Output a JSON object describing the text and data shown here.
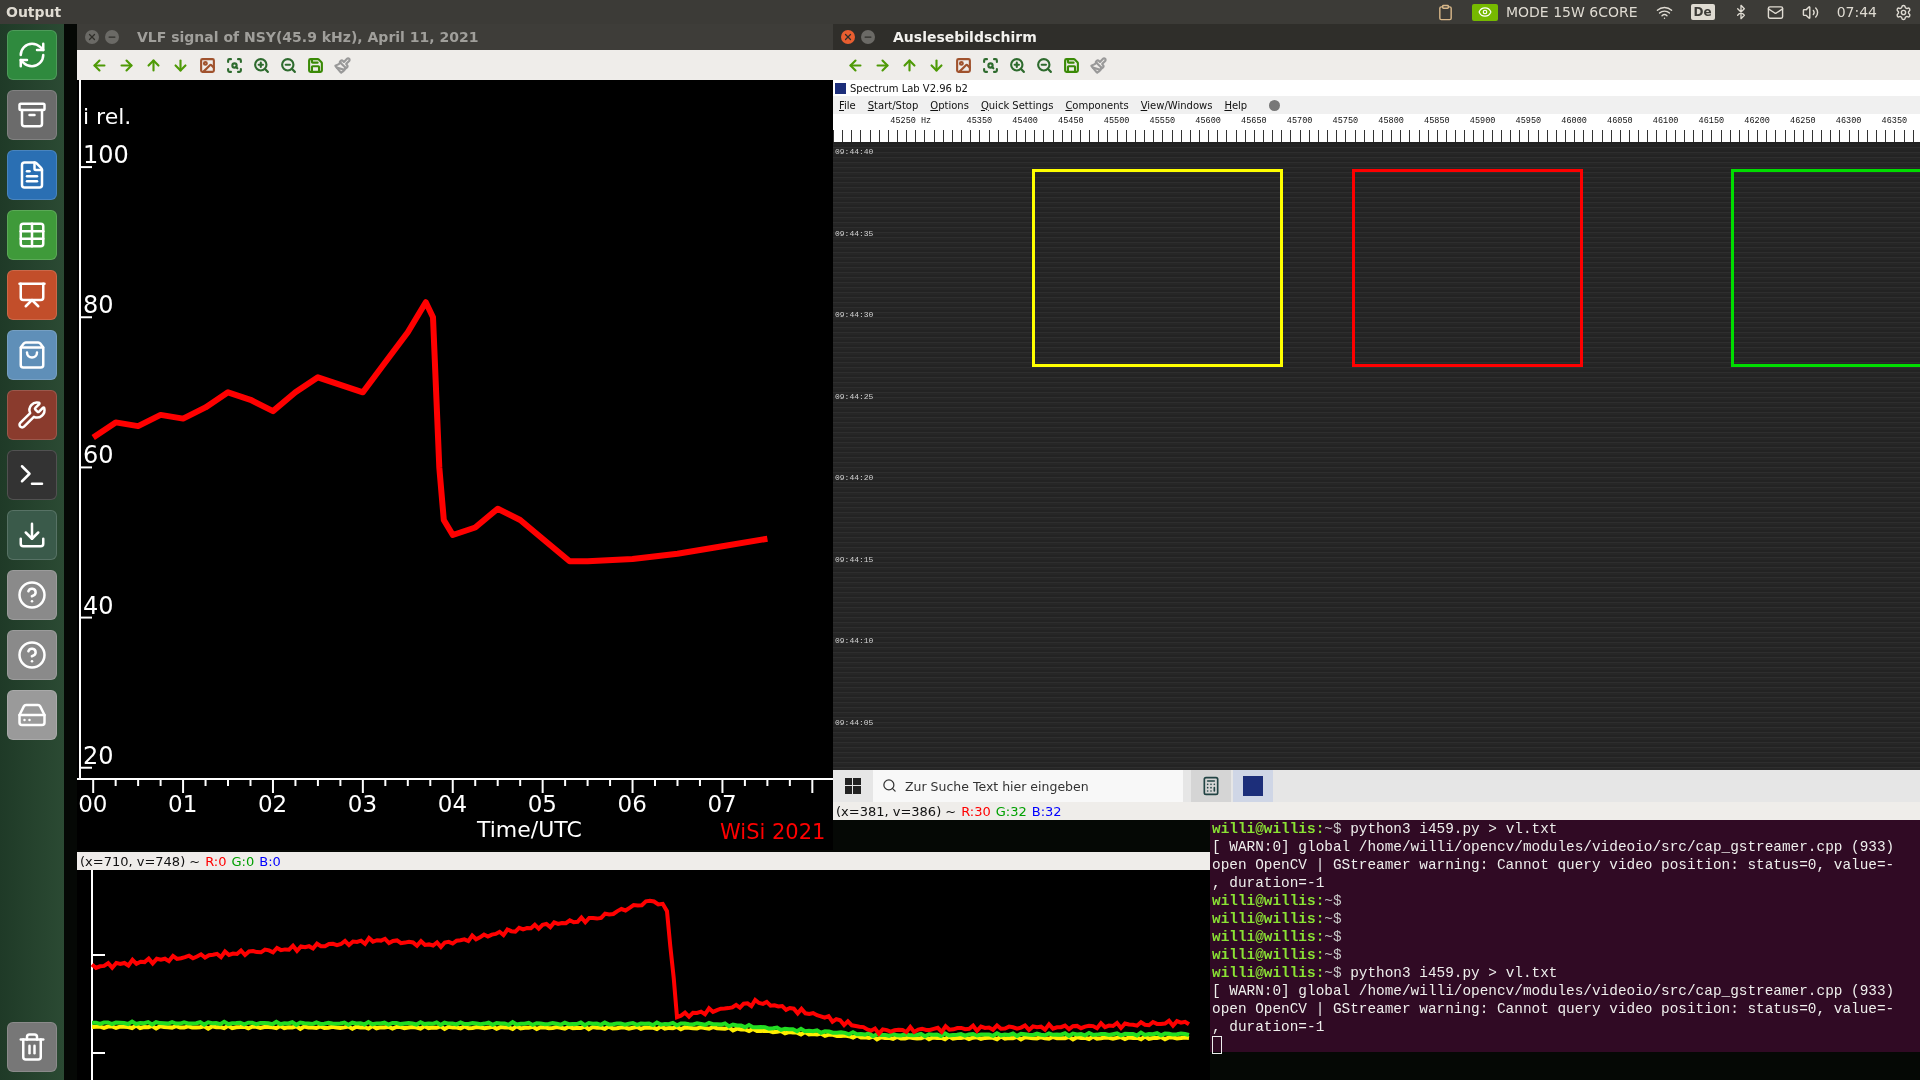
{
  "top_bar": {
    "app_title": "Output",
    "mode": "MODE 15W 6CORE",
    "keyboard": "De",
    "clock": "07:44"
  },
  "plot_window": {
    "title": "VLF signal of NSY(45.9 kHz), April 11, 2021",
    "active": false,
    "plot": {
      "credit": "WiSi 2021",
      "chart_data": {
        "type": "line",
        "xlabel": "Time/UTC",
        "ylabel": "i rel.",
        "x": [
          0,
          0.25,
          0.5,
          0.75,
          1,
          1.25,
          1.5,
          1.75,
          2,
          2.25,
          2.5,
          2.75,
          3,
          3.25,
          3.5,
          3.7,
          3.78,
          3.85,
          3.9,
          4,
          4.25,
          4.5,
          4.75,
          5,
          5.3,
          5.5,
          6,
          6.5,
          7,
          7.5
        ],
        "series": [
          {
            "color": "#ff0000",
            "values": [
              64,
              66,
              65.5,
              67,
              66.5,
              68,
              70,
              69,
              67.5,
              70,
              72,
              71,
              70,
              74,
              78,
              82,
              80,
              60,
              53,
              51,
              52,
              54.5,
              53,
              50.5,
              47.5,
              47.5,
              47.8,
              48.5,
              49.5,
              50.5
            ]
          }
        ],
        "xlim": [
          -0.18,
          8.23
        ],
        "ylim": [
          18.5,
          111.6
        ],
        "xticks": [
          {
            "value": 0,
            "label": "00"
          },
          {
            "value": 1,
            "label": "01"
          },
          {
            "value": 2,
            "label": "02"
          },
          {
            "value": 3,
            "label": "03"
          },
          {
            "value": 4,
            "label": "04"
          },
          {
            "value": 5,
            "label": "05"
          },
          {
            "value": 6,
            "label": "06"
          },
          {
            "value": 7,
            "label": "07"
          }
        ],
        "yticks": [
          20,
          40,
          60,
          80,
          100
        ]
      }
    }
  },
  "output_window": {
    "status": {
      "coords": "(x=710, v=748) ~",
      "r": "R:0",
      "g": "G:0",
      "b": "B:0"
    }
  },
  "reader_window": {
    "title": "Auslesebildschirm",
    "active": true,
    "app": {
      "title": "Spectrum Lab V2.96 b2",
      "menu": [
        "File",
        "Start/Stop",
        "Options",
        "Quick Settings",
        "Components",
        "View/Windows",
        "Help"
      ],
      "ruler_unit_label": "45250 Hz",
      "ruler_labels": [
        "45350",
        "45400",
        "45450",
        "45500",
        "45550",
        "45600",
        "45650",
        "45700",
        "45750",
        "45800",
        "45850",
        "45900",
        "45950",
        "46000",
        "46050",
        "46100",
        "46150",
        "46200",
        "46250",
        "46300",
        "46350"
      ],
      "times": [
        "09:44:40",
        "09:44:35",
        "09:44:30",
        "09:44:25",
        "09:44:20",
        "09:44:15",
        "09:44:10",
        "09:44:05"
      ],
      "frames": [
        {
          "color": "#ffff00"
        },
        {
          "color": "#ff0000"
        },
        {
          "color": "#00dd00"
        }
      ]
    },
    "taskbar": {
      "search_placeholder": "Zur Suche Text hier eingeben"
    },
    "status": {
      "coords": "(x=381, v=386) ~",
      "r": "R:30",
      "g": "G:32",
      "b": "B:32"
    }
  },
  "terminal": {
    "lines": [
      {
        "kind": "prompt",
        "user": "willi@willis:",
        "cwd": "~$",
        "command": " python3 i459.py > vl.txt"
      },
      {
        "kind": "output",
        "text": "[ WARN:0] global /home/willi/opencv/modules/videoio/src/cap_gstreamer.cpp (933)"
      },
      {
        "kind": "output",
        "text": "open OpenCV | GStreamer warning: Cannot query video position: status=0, value=-"
      },
      {
        "kind": "output",
        "text": ", duration=-1"
      },
      {
        "kind": "prompt",
        "user": "willi@willis:",
        "cwd": "~$"
      },
      {
        "kind": "prompt",
        "user": "willi@willis:",
        "cwd": "~$"
      },
      {
        "kind": "prompt",
        "user": "willi@willis:",
        "cwd": "~$"
      },
      {
        "kind": "prompt",
        "user": "willi@willis:",
        "cwd": "~$"
      },
      {
        "kind": "prompt",
        "user": "willi@willis:",
        "cwd": "~$",
        "command": " python3 i459.py > vl.txt"
      },
      {
        "kind": "output",
        "text": "[ WARN:0] global /home/willi/opencv/modules/videoio/src/cap_gstreamer.cpp (933)"
      },
      {
        "kind": "output",
        "text": "open OpenCV | GStreamer warning: Cannot query video position: status=0, value=-"
      },
      {
        "kind": "output",
        "text": ", duration=-1"
      },
      {
        "kind": "cursor"
      }
    ]
  }
}
